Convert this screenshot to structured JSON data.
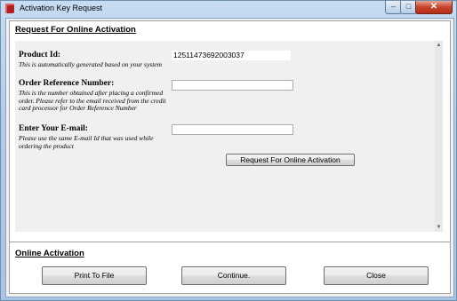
{
  "window": {
    "title": "Activation Key Request"
  },
  "window_controls": {
    "minimize": "–",
    "maximize": "□",
    "close": "✕"
  },
  "request_section": {
    "title": "Request For Online Activation"
  },
  "product_id": {
    "label": "Product Id:",
    "help": "This is automatically generated based on your system",
    "value": "12511473692003037"
  },
  "order_ref": {
    "label": "Order Reference Number:",
    "help": "This is the number obtained after placing a confirmed order. Please refer to the email received from the credit card processor for Order Reference Number",
    "value": ""
  },
  "email": {
    "label": "Enter Your E-mail:",
    "help": "Please use the same E-mail Id that was used while ordering the product",
    "value": ""
  },
  "request_button": "Request For Online Activation",
  "scrollbar": {
    "up": "▲",
    "down": "▼"
  },
  "online_section": {
    "title": "Online Activation"
  },
  "buttons": {
    "print": "Print To File",
    "continue": "Continue.",
    "close": "Close"
  }
}
